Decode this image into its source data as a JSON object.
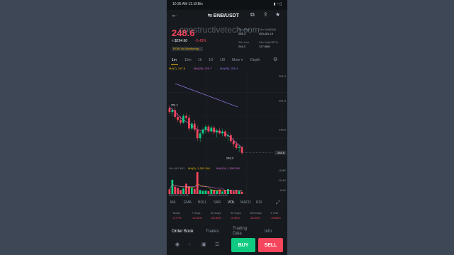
{
  "status_bar": {
    "time": "10:35 AM",
    "speed": "13.1KB/s",
    "icons": "▮ ◔ ▯"
  },
  "header": {
    "back_icon": "←",
    "pair": "⇆ BNB/USDT",
    "icons": [
      "chart-icon",
      "share-icon",
      "star-icon"
    ]
  },
  "watermark": "constructivetech.com",
  "ticker": {
    "price": "248.6",
    "usd": "≈ $264.60",
    "change": "-5.43%",
    "tag": "POW  Vol  Monitoring  ...",
    "stats": [
      {
        "label": "24h High",
        "value": "266.4"
      },
      {
        "label": "24h Vol(BNB)",
        "value": "493,461.19"
      },
      {
        "label": "24h Low",
        "value": "246.2"
      },
      {
        "label": "24h Vol(USDT)",
        "value": "127.58M"
      }
    ]
  },
  "timeframes": [
    "1m",
    "15m",
    "1h",
    "1D",
    "1M",
    "More ▾",
    "Depth"
  ],
  "selected_timeframe": "1m",
  "ma_legend": [
    {
      "text": "MA(7): 247.8",
      "color": "#f0b90b"
    },
    {
      "text": "MA(25): 249.7",
      "color": "#d66bd9"
    },
    {
      "text": "MA(99): 251.9",
      "color": "#9c7cf4"
    }
  ],
  "chart_data": {
    "type": "candlestick",
    "y_axis_ticks": [
      "254.3",
      "251.8",
      "248.8",
      "246.3"
    ],
    "ylim": [
      245.5,
      255
    ],
    "annotations": [
      {
        "text": "251.1"
      },
      {
        "text": "246.2"
      }
    ],
    "current_price_label": "248.6",
    "volume_legend": "Vol: 967.691",
    "volume_ma5": "MA(5): 1,262.344",
    "volume_ma10": "MA(10): 1,306.510",
    "volume_ticks": [
      "15.8K",
      "10.4K",
      "5.0K"
    ],
    "x_labels": [
      "2025-02-15 10:15",
      "2025-02-15 10:29"
    ],
    "candles": [
      {
        "o": 251.0,
        "h": 251.3,
        "l": 250.4,
        "c": 250.6
      },
      {
        "o": 250.6,
        "h": 251.0,
        "l": 250.2,
        "c": 250.8
      },
      {
        "o": 250.8,
        "h": 251.1,
        "l": 249.9,
        "c": 250.1
      },
      {
        "o": 250.1,
        "h": 250.5,
        "l": 249.6,
        "c": 249.8
      },
      {
        "o": 249.8,
        "h": 250.2,
        "l": 249.3,
        "c": 249.5
      },
      {
        "o": 249.5,
        "h": 250.4,
        "l": 249.4,
        "c": 250.2
      },
      {
        "o": 250.2,
        "h": 250.5,
        "l": 249.8,
        "c": 250.0
      },
      {
        "o": 250.0,
        "h": 250.3,
        "l": 248.6,
        "c": 248.9
      },
      {
        "o": 248.9,
        "h": 249.6,
        "l": 248.7,
        "c": 249.4
      },
      {
        "o": 249.4,
        "h": 249.8,
        "l": 248.6,
        "c": 248.8
      },
      {
        "o": 248.8,
        "h": 249.2,
        "l": 247.6,
        "c": 247.9
      },
      {
        "o": 247.9,
        "h": 248.6,
        "l": 247.5,
        "c": 248.4
      },
      {
        "o": 248.4,
        "h": 249.0,
        "l": 248.2,
        "c": 248.8
      },
      {
        "o": 248.8,
        "h": 249.3,
        "l": 248.4,
        "c": 249.1
      },
      {
        "o": 249.1,
        "h": 249.3,
        "l": 248.4,
        "c": 248.6
      },
      {
        "o": 248.6,
        "h": 249.2,
        "l": 248.5,
        "c": 249.0
      },
      {
        "o": 249.0,
        "h": 249.2,
        "l": 248.3,
        "c": 248.5
      },
      {
        "o": 248.5,
        "h": 248.9,
        "l": 248.0,
        "c": 248.7
      },
      {
        "o": 248.7,
        "h": 249.0,
        "l": 248.3,
        "c": 248.4
      },
      {
        "o": 248.4,
        "h": 248.9,
        "l": 248.1,
        "c": 248.6
      },
      {
        "o": 248.6,
        "h": 248.8,
        "l": 247.9,
        "c": 248.1
      },
      {
        "o": 248.1,
        "h": 248.5,
        "l": 247.6,
        "c": 248.2
      },
      {
        "o": 248.2,
        "h": 248.4,
        "l": 247.4,
        "c": 247.6
      },
      {
        "o": 247.6,
        "h": 247.9,
        "l": 247.0,
        "c": 247.3
      },
      {
        "o": 247.3,
        "h": 247.6,
        "l": 246.7,
        "c": 246.9
      },
      {
        "o": 246.9,
        "h": 247.2,
        "l": 246.5,
        "c": 247.0
      },
      {
        "o": 247.0,
        "h": 247.1,
        "l": 246.2,
        "c": 246.4
      }
    ],
    "ma25": [
      251.1,
      250.9,
      250.6,
      250.3,
      250.0,
      249.8,
      249.6,
      249.4,
      249.2,
      249.0,
      248.8,
      248.7,
      248.7,
      248.8,
      248.8,
      248.7,
      248.7,
      248.6,
      248.6,
      248.5,
      248.4,
      248.2,
      248.0,
      247.7,
      247.4,
      247.2,
      246.9
    ],
    "ma99": [
      253.9,
      253.3,
      252.7,
      252.1,
      251.5
    ],
    "volumes": [
      3.2,
      9.8,
      5.1,
      4.2,
      2.8,
      3.9,
      7.1,
      5.2,
      4.3,
      3.6,
      15.0,
      2.8,
      2.2,
      2.4,
      2.1,
      3.2,
      2.9,
      2.3,
      3.1,
      1.8,
      2.6,
      3.4,
      2.7,
      1.9,
      2.5,
      2.1,
      1.6
    ],
    "volume_max": 16
  },
  "indicators": [
    "MA",
    "EMA",
    "BOLL",
    "SAR",
    "VOL",
    "MACD",
    "RSI"
  ],
  "selected_indicator": "VOL",
  "performance": [
    {
      "label": "Today",
      "value": "-5.77%"
    },
    {
      "label": "7 Days",
      "value": "-19.43%"
    },
    {
      "label": "30 Days",
      "value": "-20.45%"
    },
    {
      "label": "90 Days",
      "value": "-8.40%"
    },
    {
      "label": "180 Days",
      "value": "-16.90%"
    },
    {
      "label": "1 Year",
      "value": "-15.65%"
    }
  ],
  "tabs": [
    "Order Book",
    "Trades",
    "Trading Data",
    "Info"
  ],
  "bottom_nav": [
    {
      "icon": "◉",
      "label": ""
    },
    {
      "icon": "◌",
      "label": ""
    },
    {
      "icon": "▣",
      "label": ""
    },
    {
      "icon": "☰",
      "label": ""
    }
  ],
  "buttons": {
    "buy": "BUY",
    "sell": "SELL"
  },
  "colors": {
    "up": "#0ecb81",
    "down": "#f6465d",
    "accent": "#f0b90b"
  }
}
